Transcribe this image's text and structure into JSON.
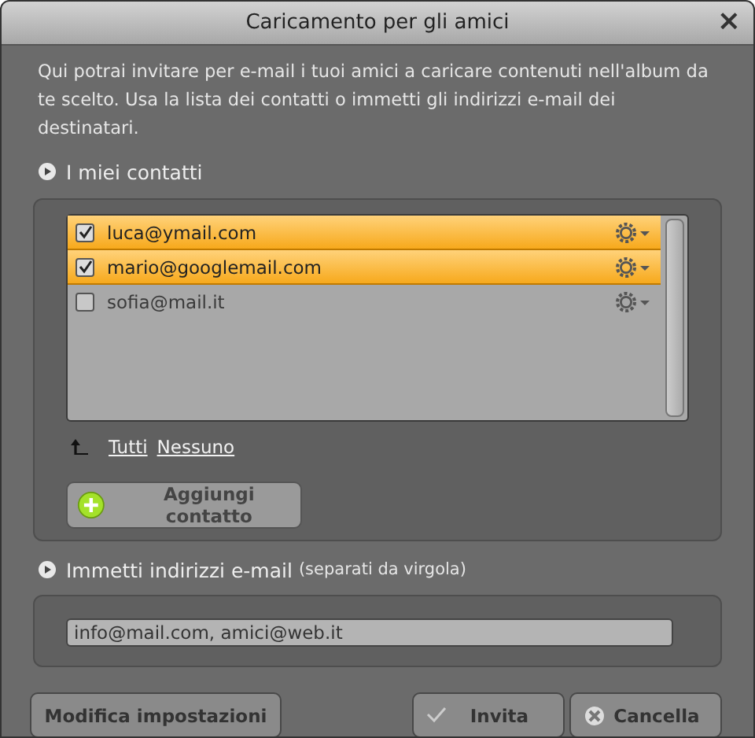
{
  "window": {
    "title": "Caricamento per gli amici",
    "close": "×"
  },
  "description": "Qui potrai invitare per e-mail i tuoi amici a caricare contenuti nell'album da te scelto. Usa la lista dei contatti o immetti gli indirizzi e-mail dei destinatari.",
  "contacts_section": {
    "title": "I miei contatti",
    "contacts": [
      {
        "email": "luca@ymail.com",
        "checked": true
      },
      {
        "email": "mario@googlemail.com",
        "checked": true
      },
      {
        "email": "sofia@mail.it",
        "checked": false
      }
    ],
    "links": [
      "Tutti",
      "Nessuno"
    ],
    "add_button": "Aggiungi contatto"
  },
  "email_section": {
    "title": "Immetti indirizzi e-mail",
    "hint": "(separati da virgola)",
    "value": "info@mail.com, amici@web.it"
  },
  "buttons": [
    {
      "label": "Modifica impostazioni",
      "kind": "plain"
    },
    {
      "label": "Invita",
      "kind": "ok"
    },
    {
      "label": "Cancella",
      "kind": "cancel"
    }
  ]
}
